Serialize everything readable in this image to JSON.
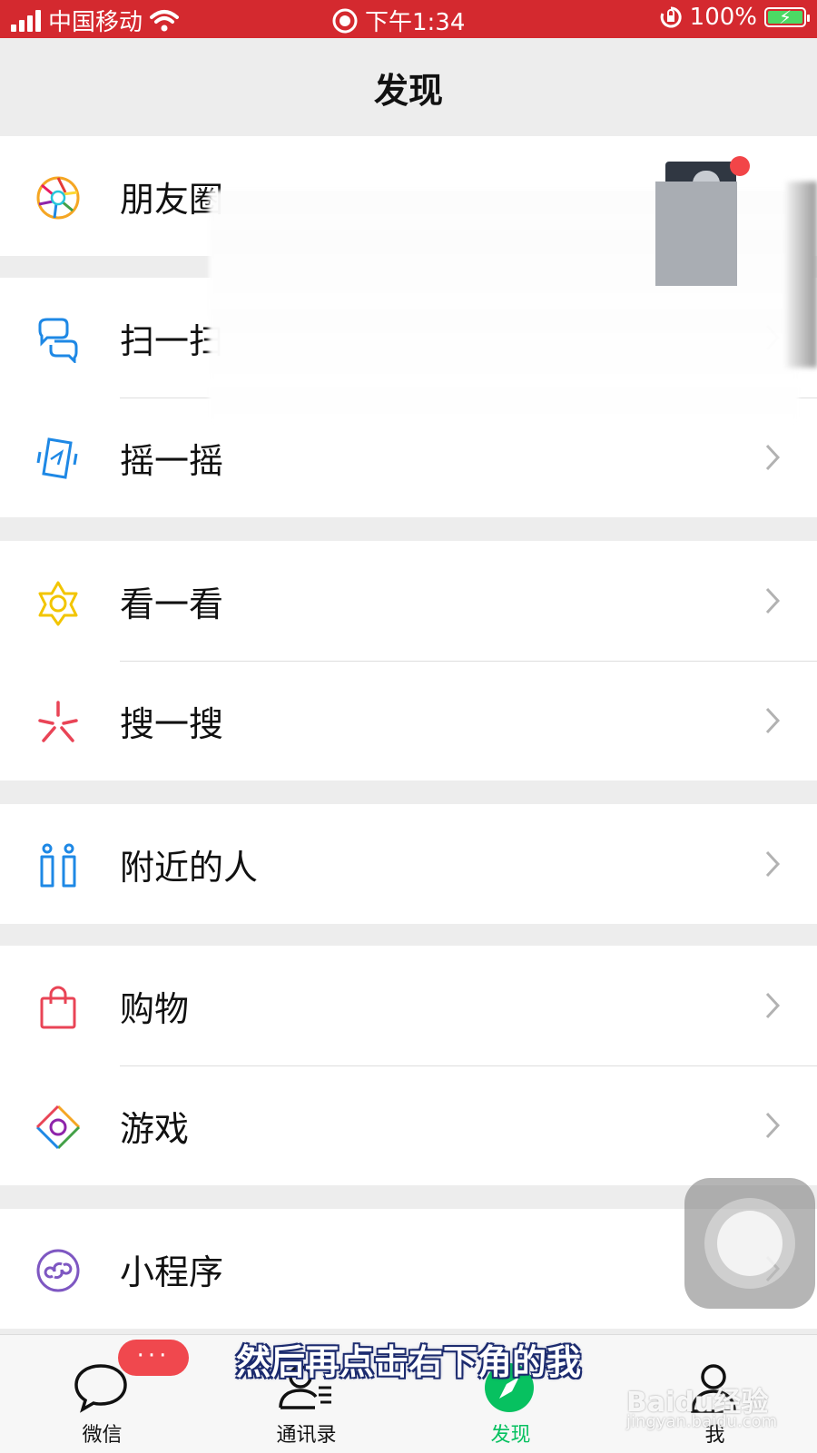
{
  "status_bar": {
    "carrier": "中国移动",
    "time": "下午1:34",
    "battery_text": "100%",
    "battery_level": 1.0
  },
  "nav": {
    "title": "发现"
  },
  "moments_row": {
    "label": "朋友圈",
    "has_new": true
  },
  "menu": {
    "scan": "扫一扫",
    "shake": "摇一摇",
    "look": "看一看",
    "search": "搜一搜",
    "nearby": "附近的人",
    "shopping": "购物",
    "games": "游戏",
    "mini_programs": "小程序"
  },
  "tab_bar": {
    "tabs": [
      {
        "label": "微信",
        "icon": "chat-bubble-icon"
      },
      {
        "label": "通讯录",
        "icon": "contacts-icon"
      },
      {
        "label": "发现",
        "icon": "compass-icon",
        "active": true
      },
      {
        "label": "我",
        "icon": "person-icon"
      }
    ],
    "badge_text": "···"
  },
  "caption": "然后再点击右下角的我",
  "watermark": {
    "brand": "Baidu经验",
    "url": "jingyan.baidu.com"
  },
  "colors": {
    "status_bar": "#d4292f",
    "accent_green": "#07c160",
    "badge_red": "#f0484e",
    "background": "#ededed"
  }
}
